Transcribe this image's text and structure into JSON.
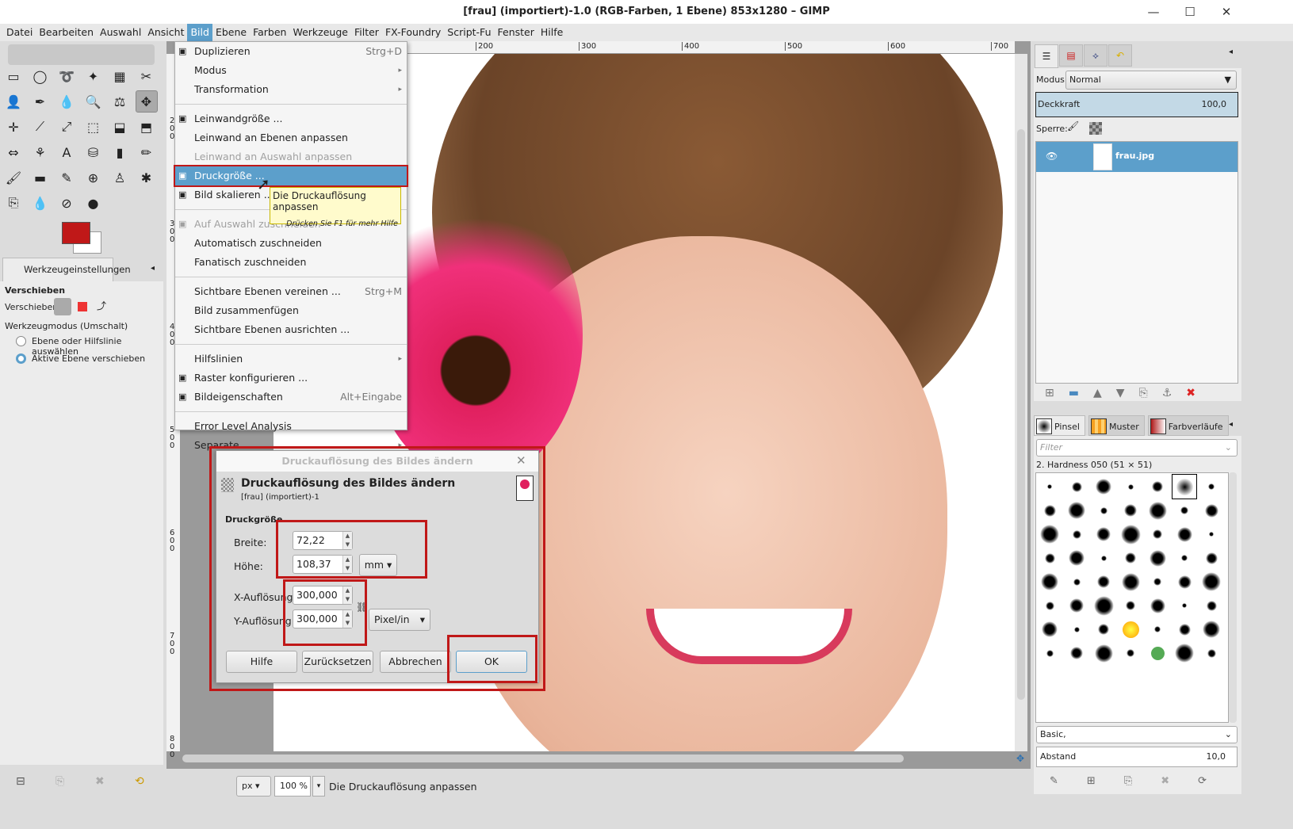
{
  "window": {
    "title": "[frau] (importiert)-1.0 (RGB-Farben, 1 Ebene) 853x1280 – GIMP",
    "minimize": "—",
    "maximize": "☐",
    "close": "✕"
  },
  "menubar": [
    "Datei",
    "Bearbeiten",
    "Auswahl",
    "Ansicht",
    "Bild",
    "Ebene",
    "Farben",
    "Werkzeuge",
    "Filter",
    "FX-Foundry",
    "Script-Fu",
    "Fenster",
    "Hilfe"
  ],
  "menu": [
    {
      "label": "Duplizieren",
      "shortcut": "Strg+D",
      "icon": "duplicate-icon"
    },
    {
      "label": "Modus",
      "submenu": true
    },
    {
      "label": "Transformation",
      "submenu": true
    },
    {
      "sep": true
    },
    {
      "label": "Leinwandgröße ...",
      "icon": "canvas-size-icon"
    },
    {
      "label": "Leinwand an Ebenen anpassen"
    },
    {
      "label": "Leinwand an Auswahl anpassen",
      "disabled": true
    },
    {
      "label": "Druckgröße ...",
      "icon": "print-size-icon",
      "highlighted": true
    },
    {
      "label": "Bild skalieren ...",
      "icon": "scale-image-icon"
    },
    {
      "sep": true
    },
    {
      "label": "Auf Auswahl zuschneiden",
      "disabled": true,
      "icon": "crop-icon"
    },
    {
      "label": "Automatisch zuschneiden"
    },
    {
      "label": "Fanatisch zuschneiden"
    },
    {
      "sep": true
    },
    {
      "label": "Sichtbare Ebenen vereinen ...",
      "shortcut": "Strg+M"
    },
    {
      "label": "Bild zusammenfügen"
    },
    {
      "label": "Sichtbare Ebenen ausrichten ..."
    },
    {
      "sep": true
    },
    {
      "label": "Hilfslinien",
      "submenu": true
    },
    {
      "label": "Raster konfigurieren ...",
      "icon": "grid-icon"
    },
    {
      "label": "Bildeigenschaften",
      "shortcut": "Alt+Eingabe",
      "icon": "image-properties-icon"
    },
    {
      "sep": true
    },
    {
      "label": "Error Level Analysis"
    },
    {
      "label": "Separate",
      "submenu": true
    }
  ],
  "tooltip": {
    "text": "Die Druckauflösung anpassen",
    "hint": "Drücken Sie F1 für mehr Hilfe"
  },
  "tools": [
    "▭",
    "◯",
    "➰",
    "✦",
    "▦",
    "✂",
    "👤",
    "✒",
    "💧",
    "🔍",
    "⚖",
    "✥",
    "✛",
    "⟋",
    "⤢",
    "⬚",
    "⬓",
    "⬒",
    "⇔",
    "⚘",
    "A",
    "⛁",
    "▮",
    "✏",
    "🖌",
    "▬",
    "✎",
    "⊕",
    "♙",
    "✱",
    "⎘",
    "💧",
    "⊘",
    "●"
  ],
  "colors": {
    "foreground": "#c01818",
    "background": "#ffffff",
    "accent": "#5c9fcb",
    "highlight_box": "#c01818"
  },
  "tool_options": {
    "tab": "Werkzeugeinstellungen",
    "title": "Verschieben",
    "move_label": "Verschieben:",
    "mode_label": "Werkzeugmodus (Umschalt)",
    "radio1": "Ebene oder Hilfslinie auswählen",
    "radio2": "Aktive Ebene verschieben"
  },
  "rulers": {
    "top": [
      "200",
      "300",
      "400",
      "500",
      "600",
      "700"
    ],
    "left": [
      "2",
      "3",
      "4",
      "5",
      "6",
      "7",
      "8"
    ]
  },
  "dialog": {
    "window_title": "Druckauflösung des Bildes ändern",
    "heading": "Druckauflösung des Bildes ändern",
    "subtitle": "[frau] (importiert)-1",
    "section": "Druckgröße",
    "width_label": "Breite:",
    "width_value": "72,22",
    "height_label": "Höhe:",
    "height_value": "108,37",
    "size_unit": "mm",
    "xres_label": "X-Auflösung:",
    "xres_value": "300,000",
    "yres_label": "Y-Auflösung:",
    "yres_value": "300,000",
    "res_unit": "Pixel/in",
    "help": "Hilfe",
    "reset": "Zurücksetzen",
    "cancel": "Abbrechen",
    "ok": "OK"
  },
  "statusbar": {
    "unit": "px",
    "zoom": "100 %",
    "message": "Die Druckauflösung anpassen"
  },
  "layers": {
    "mode_label": "Modus:",
    "mode_value": "Normal",
    "opacity_label": "Deckkraft",
    "opacity_value": "100,0",
    "lock_label": "Sperre:",
    "layer_name": "frau.jpg"
  },
  "brushes": {
    "tabs": [
      "Pinsel",
      "Muster",
      "Farbverläufe"
    ],
    "filter_placeholder": "Filter",
    "brush_name": "2. Hardness 050 (51 × 51)",
    "preset": "Basic,",
    "spacing_label": "Abstand",
    "spacing_value": "10,0"
  }
}
